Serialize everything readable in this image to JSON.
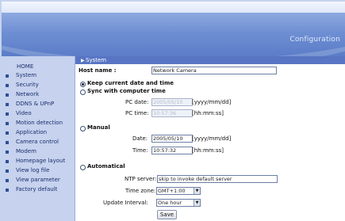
{
  "header": {
    "title": "Configuration"
  },
  "sidebar": {
    "items": [
      {
        "label": "HOME"
      },
      {
        "label": "System"
      },
      {
        "label": "Security"
      },
      {
        "label": "Network"
      },
      {
        "label": "DDNS & UPnP"
      },
      {
        "label": "Video"
      },
      {
        "label": "Motion detection"
      },
      {
        "label": "Application"
      },
      {
        "label": "Camera control"
      },
      {
        "label": "Modem"
      },
      {
        "label": "Homepage layout"
      },
      {
        "label": "View log file"
      },
      {
        "label": "View parameter"
      },
      {
        "label": "Factory default"
      }
    ]
  },
  "main": {
    "section_title": "System",
    "host_label": "Host name :",
    "host_value": "Network Camera",
    "options": {
      "keep": "Keep current date and time",
      "sync": "Sync with computer time",
      "manual": "Manual",
      "automatical": "Automatical"
    },
    "sync": {
      "pc_date_label": "PC date:",
      "pc_date_value": "2005/05/10",
      "pc_date_hint": "[yyyy/mm/dd]",
      "pc_time_label": "PC time:",
      "pc_time_value": "10:57:36",
      "pc_time_hint": "[hh:mm:ss]"
    },
    "manual": {
      "date_label": "Date:",
      "date_value": "2005/05/10",
      "date_hint": "[yyyy/mm/dd]",
      "time_label": "Time:",
      "time_value": "10:57:32",
      "time_hint": "[hh:mm:ss]"
    },
    "auto": {
      "ntp_label": "NTP server:",
      "ntp_value": "skip to invoke default server",
      "tz_label": "Time zone:",
      "tz_value": "GMT+1:00",
      "interval_label": "Update Interval:",
      "interval_value": "One hour"
    },
    "save_label": "Save"
  },
  "colors": {
    "banner": "#6f8fd3",
    "section_bar": "#5875c4",
    "sidebar": "#c6d2ee"
  }
}
